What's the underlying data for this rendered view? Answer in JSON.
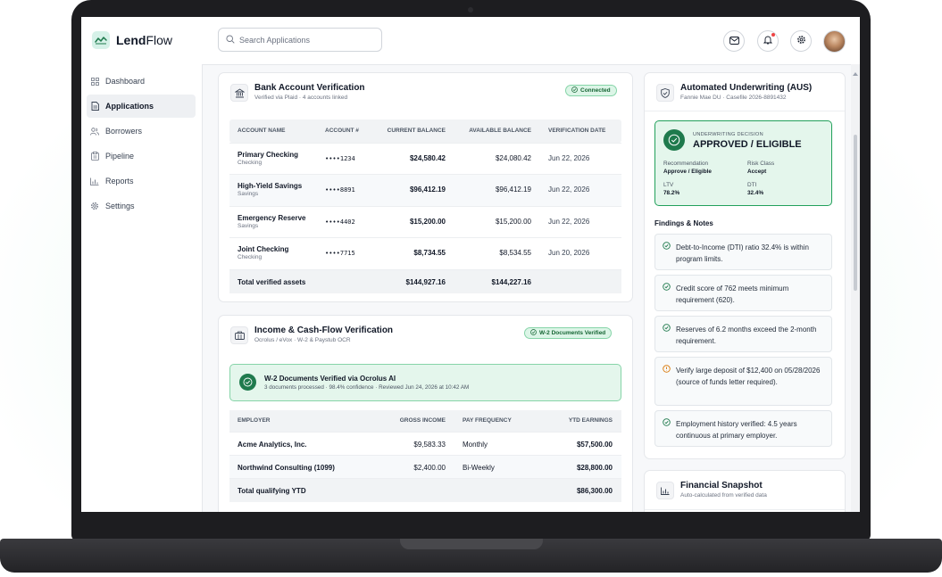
{
  "app": {
    "brand": "LendFlow",
    "accent_color": "#1f7a4d"
  },
  "sidebar": {
    "items": [
      {
        "label": "Dashboard",
        "icon": "grid-icon"
      },
      {
        "label": "Applications",
        "icon": "document-icon",
        "active": true
      },
      {
        "label": "Borrowers",
        "icon": "users-icon"
      },
      {
        "label": "Pipeline",
        "icon": "clipboard-icon"
      },
      {
        "label": "Reports",
        "icon": "bar-chart-icon"
      },
      {
        "label": "Settings",
        "icon": "gear-icon"
      }
    ]
  },
  "header": {
    "search_placeholder": "Search Applications",
    "icons": [
      "mail-icon",
      "bell-icon",
      "settings-icon",
      "avatar"
    ]
  },
  "bank": {
    "title": "Bank Account Verification",
    "subtitle": "Verified via Plaid · 4 accounts linked",
    "status": "Connected",
    "columns": [
      "ACCOUNT NAME",
      "ACCOUNT #",
      "CURRENT BALANCE",
      "AVAILABLE BALANCE",
      "VERIFICATION DATE"
    ],
    "rows": [
      {
        "name": "Primary Checking",
        "type": "Checking",
        "number": "••••1234",
        "current": "$24,580.42",
        "available": "$24,080.42",
        "date": "Jun 22, 2026"
      },
      {
        "name": "High-Yield Savings",
        "type": "Savings",
        "number": "••••8891",
        "current": "$96,412.19",
        "available": "$96,412.19",
        "date": "Jun 22, 2026"
      },
      {
        "name": "Emergency Reserve",
        "type": "Savings",
        "number": "••••4402",
        "current": "$15,200.00",
        "available": "$15,200.00",
        "date": "Jun 22, 2026"
      },
      {
        "name": "Joint Checking",
        "type": "Checking",
        "number": "••••7715",
        "current": "$8,734.55",
        "available": "$8,534.55",
        "date": "Jun 20, 2026"
      }
    ],
    "total": {
      "label": "Total verified assets",
      "current": "$144,927.16",
      "available": "$144,227.16"
    }
  },
  "income": {
    "title": "Income & Cash-Flow Verification",
    "subtitle": "Ocrolus / eVox · W-2 & Paystub OCR",
    "status": "W-2 Documents Verified",
    "banner_title": "W-2 Documents Verified via Ocrolus AI",
    "banner_sub": "3 documents processed · 98.4% confidence · Reviewed Jun 24, 2026 at 10:42 AM",
    "columns": [
      "EMPLOYER",
      "GROSS INCOME",
      "PAY FREQUENCY",
      "YTD EARNINGS"
    ],
    "rows": [
      {
        "employer": "Acme Analytics, Inc.",
        "gross": "$9,583.33",
        "freq": "Monthly",
        "ytd": "$57,500.00"
      },
      {
        "employer": "Northwind Consulting (1099)",
        "gross": "$2,400.00",
        "freq": "Bi-Weekly",
        "ytd": "$28,800.00"
      }
    ],
    "total": {
      "label": "Total qualifying YTD",
      "ytd": "$86,300.00"
    }
  },
  "aus": {
    "title": "Automated Underwriting (AUS)",
    "subtitle": "Fannie Mae DU · Casefile 2026-8891432",
    "decision_label": "UNDERWRITING DECISION",
    "decision": "APPROVED / ELIGIBLE",
    "metrics": [
      {
        "label": "Recommendation",
        "value": "Approve / Eligible"
      },
      {
        "label": "Risk Class",
        "value": "Accept"
      },
      {
        "label": "LTV",
        "value": "78.2%"
      },
      {
        "label": "DTI",
        "value": "32.4%"
      }
    ],
    "findings_title": "Findings & Notes",
    "findings": [
      {
        "status": "ok",
        "text": "Debt-to-Income (DTI) ratio 32.4% is within program limits."
      },
      {
        "status": "ok",
        "text": "Credit score of 762 meets minimum requirement (620)."
      },
      {
        "status": "ok",
        "text": "Reserves of 6.2 months exceed the 2-month requirement."
      },
      {
        "status": "warning",
        "text": "Verify large deposit of $12,400 on 05/28/2026 (source of funds letter required)."
      },
      {
        "status": "ok",
        "text": "Employment history verified: 4.5 years continuous at primary employer."
      }
    ]
  },
  "snapshot": {
    "title": "Financial Snapshot",
    "subtitle": "Auto-calculated from verified data"
  }
}
